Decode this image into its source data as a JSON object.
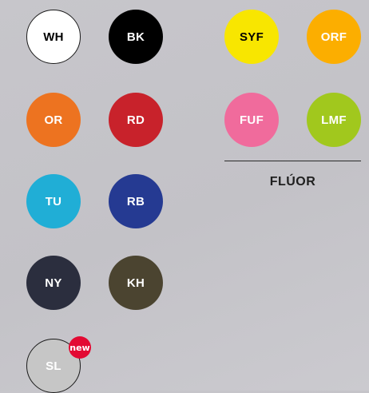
{
  "swatches": {
    "wh": {
      "code": "WH",
      "color": "#ffffff"
    },
    "bk": {
      "code": "BK",
      "color": "#000000"
    },
    "or": {
      "code": "OR",
      "color": "#ed7320"
    },
    "rd": {
      "code": "RD",
      "color": "#c8222b"
    },
    "tu": {
      "code": "TU",
      "color": "#20aed6"
    },
    "rb": {
      "code": "RB",
      "color": "#253a92"
    },
    "ny": {
      "code": "NY",
      "color": "#2b2e3e"
    },
    "kh": {
      "code": "KH",
      "color": "#4b4430"
    },
    "sl": {
      "code": "SL",
      "color": "#c6c6c6"
    },
    "syf": {
      "code": "SYF",
      "color": "#f8e600"
    },
    "orf": {
      "code": "ORF",
      "color": "#fcae00"
    },
    "fuf": {
      "code": "FUF",
      "color": "#f06b9c"
    },
    "lmf": {
      "code": "LMF",
      "color": "#a1c81d"
    }
  },
  "new_badge": {
    "label": "new",
    "color": "#e30a33"
  },
  "fluor_group": {
    "label": "FLÚOR"
  }
}
